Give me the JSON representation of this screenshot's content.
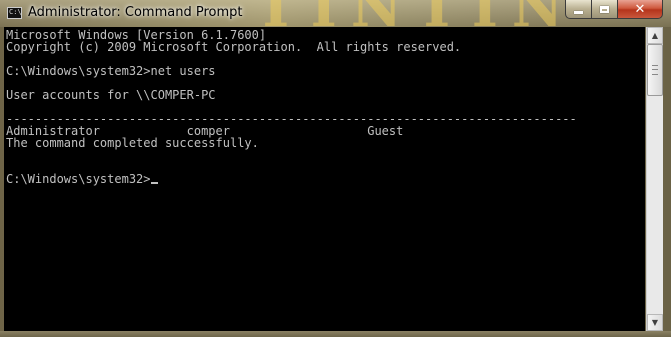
{
  "window": {
    "title": "Administrator: Command Prompt",
    "icon_name": "command-prompt-icon",
    "icon_text": "C:\\"
  },
  "wallpaper": {
    "visible_text": "TINTIN"
  },
  "controls": {
    "minimize": "minimize-icon",
    "maximize": "maximize-icon",
    "close": "close-icon",
    "close_glyph": "✕"
  },
  "console": {
    "text": "Microsoft Windows [Version 6.1.7600]\nCopyright (c) 2009 Microsoft Corporation.  All rights reserved.\n\nC:\\Windows\\system32>net users\n\nUser accounts for \\\\COMPER-PC\n\n-------------------------------------------------------------------------------\nAdministrator            comper                   Guest\nThe command completed successfully.\n\n\nC:\\Windows\\system32>",
    "foreground": "#c0c0c0",
    "background": "#000000"
  },
  "scrollbar": {
    "up_glyph": "▲",
    "down_glyph": "▼"
  }
}
